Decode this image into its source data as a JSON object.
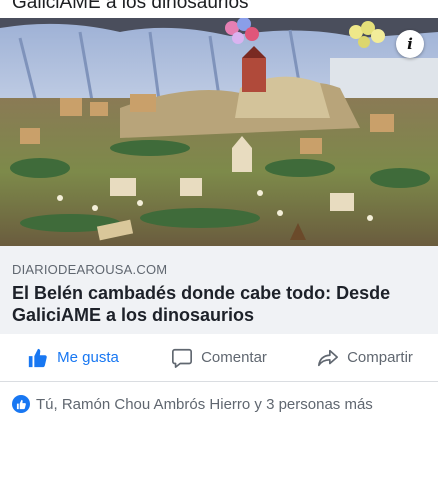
{
  "post": {
    "cut_title": "GaliciAME a los dinosaurios",
    "domain": "DIARIODEAROUSA.COM",
    "headline": "El Belén cambadés donde cabe todo: Desde GaliciAME a los dinosaurios",
    "info_glyph": "i"
  },
  "actions": {
    "like_label": "Me gusta",
    "comment_label": "Comentar",
    "share_label": "Compartir"
  },
  "reactions": {
    "summary": "Tú, Ramón Chou Ambrós Hierro y 3 personas más"
  },
  "colors": {
    "accent": "#1877f2",
    "muted_text": "#606770",
    "link_box_bg": "#f0f2f5"
  },
  "icons": [
    "like-icon",
    "comment-icon",
    "share-icon",
    "info-icon",
    "like-badge-icon"
  ]
}
